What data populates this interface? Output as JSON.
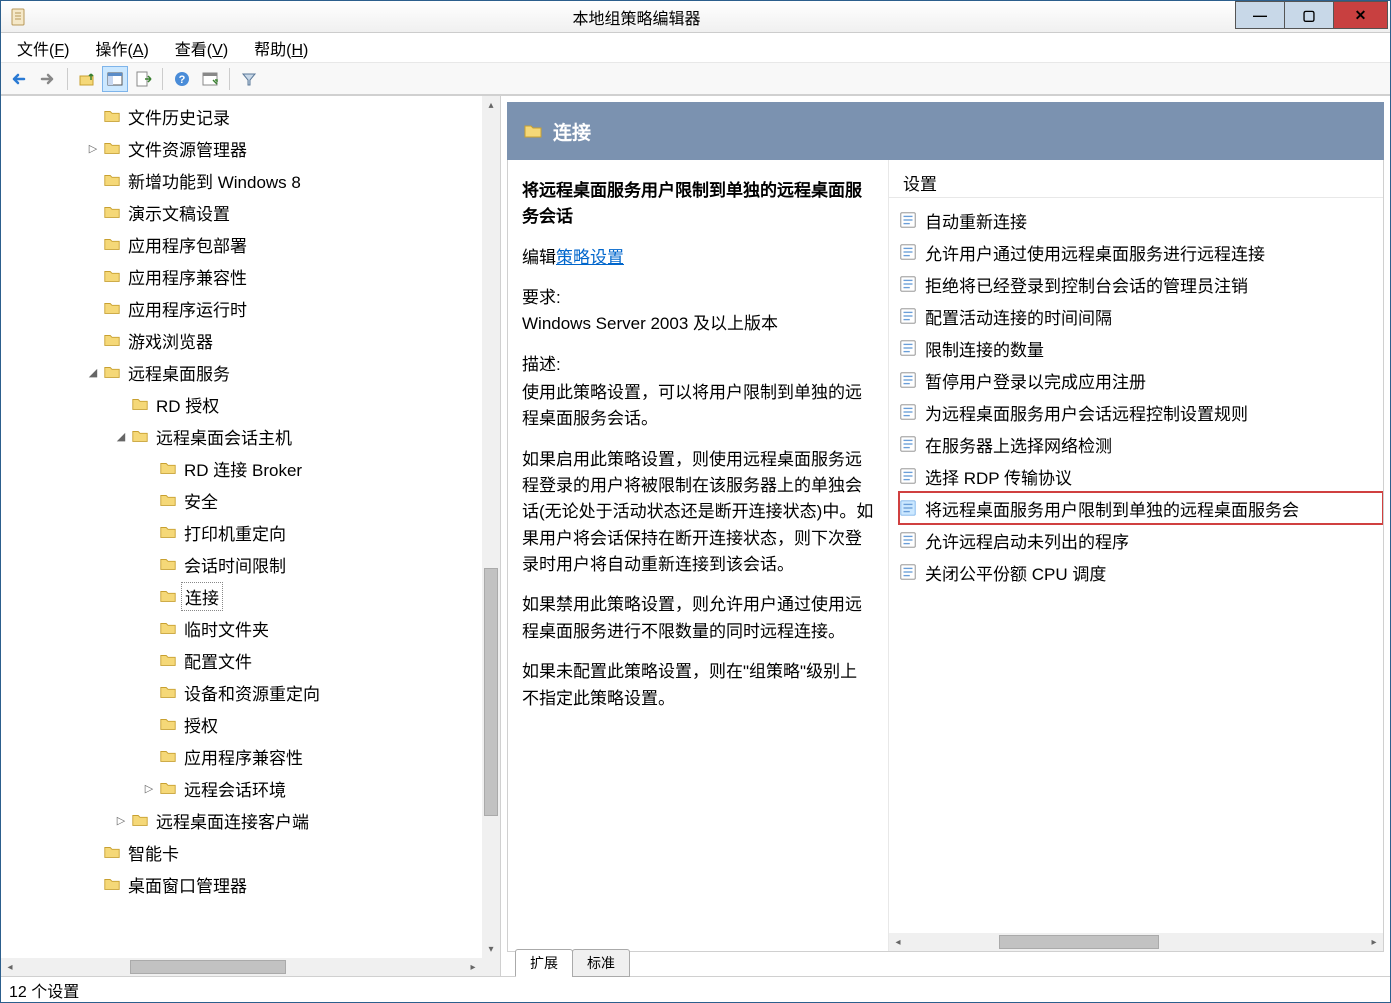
{
  "window": {
    "title": "本地组策略编辑器"
  },
  "menu": {
    "file": "文件(F)",
    "action": "操作(A)",
    "view": "查看(V)",
    "help": "帮助(H)"
  },
  "tree": {
    "items": [
      {
        "indent": 3,
        "expander": "",
        "label": "文件历史记录"
      },
      {
        "indent": 3,
        "expander": "▷",
        "label": "文件资源管理器"
      },
      {
        "indent": 3,
        "expander": "",
        "label": "新增功能到 Windows 8"
      },
      {
        "indent": 3,
        "expander": "",
        "label": "演示文稿设置"
      },
      {
        "indent": 3,
        "expander": "",
        "label": "应用程序包部署"
      },
      {
        "indent": 3,
        "expander": "",
        "label": "应用程序兼容性"
      },
      {
        "indent": 3,
        "expander": "",
        "label": "应用程序运行时"
      },
      {
        "indent": 3,
        "expander": "",
        "label": "游戏浏览器"
      },
      {
        "indent": 3,
        "expander": "◢",
        "label": "远程桌面服务"
      },
      {
        "indent": 4,
        "expander": "",
        "label": "RD 授权"
      },
      {
        "indent": 4,
        "expander": "◢",
        "label": "远程桌面会话主机"
      },
      {
        "indent": 5,
        "expander": "",
        "label": "RD 连接 Broker"
      },
      {
        "indent": 5,
        "expander": "",
        "label": "安全"
      },
      {
        "indent": 5,
        "expander": "",
        "label": "打印机重定向"
      },
      {
        "indent": 5,
        "expander": "",
        "label": "会话时间限制"
      },
      {
        "indent": 5,
        "expander": "",
        "label": "连接",
        "selected": true
      },
      {
        "indent": 5,
        "expander": "",
        "label": "临时文件夹"
      },
      {
        "indent": 5,
        "expander": "",
        "label": "配置文件"
      },
      {
        "indent": 5,
        "expander": "",
        "label": "设备和资源重定向"
      },
      {
        "indent": 5,
        "expander": "",
        "label": "授权"
      },
      {
        "indent": 5,
        "expander": "",
        "label": "应用程序兼容性"
      },
      {
        "indent": 5,
        "expander": "▷",
        "label": "远程会话环境"
      },
      {
        "indent": 4,
        "expander": "▷",
        "label": "远程桌面连接客户端"
      },
      {
        "indent": 3,
        "expander": "",
        "label": "智能卡"
      },
      {
        "indent": 3,
        "expander": "",
        "label": "桌面窗口管理器"
      }
    ]
  },
  "detail": {
    "header": "连接",
    "settingTitle": "将远程桌面服务用户限制到单独的远程桌面服务会话",
    "editPrefix": "编辑",
    "editLink": "策略设置",
    "reqLabel": "要求:",
    "reqText": "Windows Server 2003 及以上版本",
    "descLabel": "描述:",
    "descText1": "使用此策略设置，可以将用户限制到单独的远程桌面服务会话。",
    "descText2": "如果启用此策略设置，则使用远程桌面服务远程登录的用户将被限制在该服务器上的单独会话(无论处于活动状态还是断开连接状态)中。如果用户将会话保持在断开连接状态，则下次登录时用户将自动重新连接到该会话。",
    "descText3": "如果禁用此策略设置，则允许用户通过使用远程桌面服务进行不限数量的同时远程连接。",
    "descText4": "如果未配置此策略设置，则在\"组策略\"级别上不指定此策略设置。",
    "settingsHeader": "设置",
    "settings": [
      "自动重新连接",
      "允许用户通过使用远程桌面服务进行远程连接",
      "拒绝将已经登录到控制台会话的管理员注销",
      "配置活动连接的时间间隔",
      "限制连接的数量",
      "暂停用户登录以完成应用注册",
      "为远程桌面服务用户会话远程控制设置规则",
      "在服务器上选择网络检测",
      "选择 RDP 传输协议",
      "将远程桌面服务用户限制到单独的远程桌面服务会",
      "允许远程启动未列出的程序",
      "关闭公平份额 CPU 调度"
    ],
    "highlightedIndex": 9
  },
  "tabs": {
    "extended": "扩展",
    "standard": "标准"
  },
  "status": "12 个设置"
}
